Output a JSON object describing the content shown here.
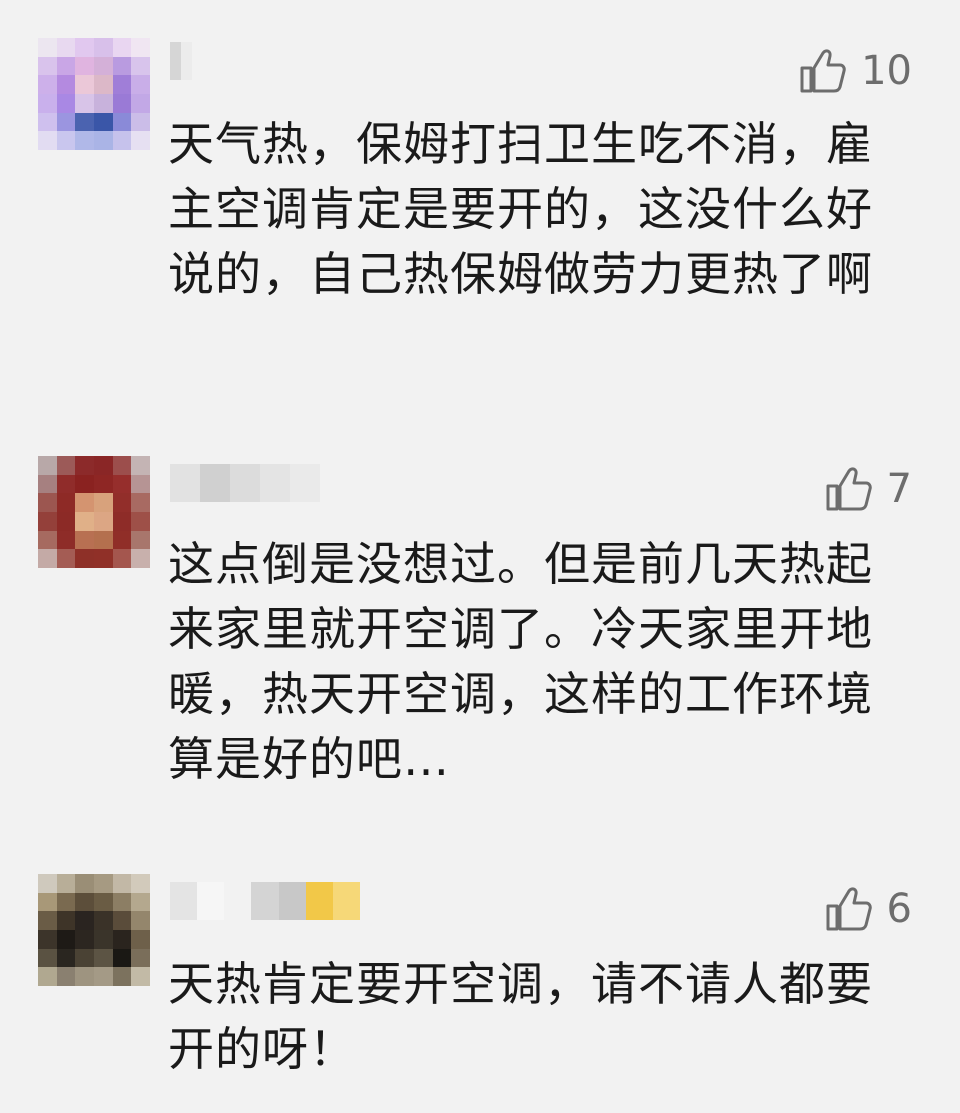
{
  "comments": [
    {
      "likes": "10",
      "text": "天气热，保姆打扫卫生吃不消，雇主空调肯定是要开的，这没什么好说的，自己热保姆做劳力更热了啊",
      "avatar_colors": [
        "#ece6f0",
        "#e8d9f0",
        "#e1c8ef",
        "#d8c0ea",
        "#e9d6f1",
        "#f0e6f2",
        "#d9c3ec",
        "#c9a6e6",
        "#e0b4e0",
        "#d4b0d8",
        "#b99be0",
        "#d8c4ec",
        "#cdb0ea",
        "#b48ae0",
        "#ebc8d8",
        "#dcb8c8",
        "#a07ed8",
        "#c9aee8",
        "#c9b0ec",
        "#a988e4",
        "#d8c4e8",
        "#c8b2dc",
        "#9a7ad6",
        "#c2a8e6",
        "#cfc0ee",
        "#9b95e0",
        "#4b63b0",
        "#3a56a8",
        "#8a8ad8",
        "#cbbde8",
        "#e2dcf2",
        "#c9c6ee",
        "#b0b8e8",
        "#aab4e6",
        "#c6c2ec",
        "#e6e0f2"
      ],
      "name_colors": [
        "#d6d6d6",
        "#ececec"
      ]
    },
    {
      "likes": "7",
      "text": "这点倒是没想过。但是前几天热起来家里就开空调了。冷天家里开地暖，热天开空调，这样的工作环境算是好的吧…",
      "avatar_colors": [
        "#b8a8a8",
        "#9c5a58",
        "#8c2a2a",
        "#8a2626",
        "#9c4e4c",
        "#c4b4b4",
        "#a68080",
        "#902c2a",
        "#8a2220",
        "#8e2624",
        "#962e2c",
        "#b69494",
        "#9c5650",
        "#8e2a26",
        "#d49470",
        "#d8a27c",
        "#922e2a",
        "#a86a62",
        "#94403a",
        "#8c2a26",
        "#e0b088",
        "#dca684",
        "#8e2c28",
        "#9e5048",
        "#a66a60",
        "#8e2c28",
        "#b87052",
        "#b4704e",
        "#902e28",
        "#a8766c",
        "#c4aaa6",
        "#a45c54",
        "#8e3028",
        "#903028",
        "#a4564e",
        "#c8b0ac"
      ],
      "name_colors": [
        "#e2e2e2",
        "#d0d0d0",
        "#dcdcdc",
        "#e4e4e4",
        "#eaeaea"
      ]
    },
    {
      "likes": "6",
      "text": "天热肯定要开空调，请不请人都要开的呀！",
      "avatar_colors": [
        "#cfc9bd",
        "#b8ae98",
        "#9a8e76",
        "#a69a82",
        "#c2b8a6",
        "#d2cabb",
        "#a89878",
        "#7a6a50",
        "#5c4e3a",
        "#6a5c44",
        "#8c7e64",
        "#b4a88e",
        "#6a5c46",
        "#3e3428",
        "#2a2420",
        "#3a3228",
        "#5a4c3a",
        "#94866c",
        "#3c342a",
        "#1e1a16",
        "#2c2620",
        "#3a342a",
        "#2a241e",
        "#6e604a",
        "#5a5242",
        "#2a2620",
        "#4a4234",
        "#5c5444",
        "#1a1814",
        "#7a6e5a",
        "#b0a890",
        "#8a8070",
        "#9e9480",
        "#a49a86",
        "#7c725e",
        "#c2baa6"
      ],
      "name_colors": [
        "#e4e4e4",
        "#f6f6f6",
        "#f2f2f2",
        "#d4d4d4",
        "#c8c8c8",
        "#f2c848",
        "#f6d878"
      ]
    }
  ]
}
